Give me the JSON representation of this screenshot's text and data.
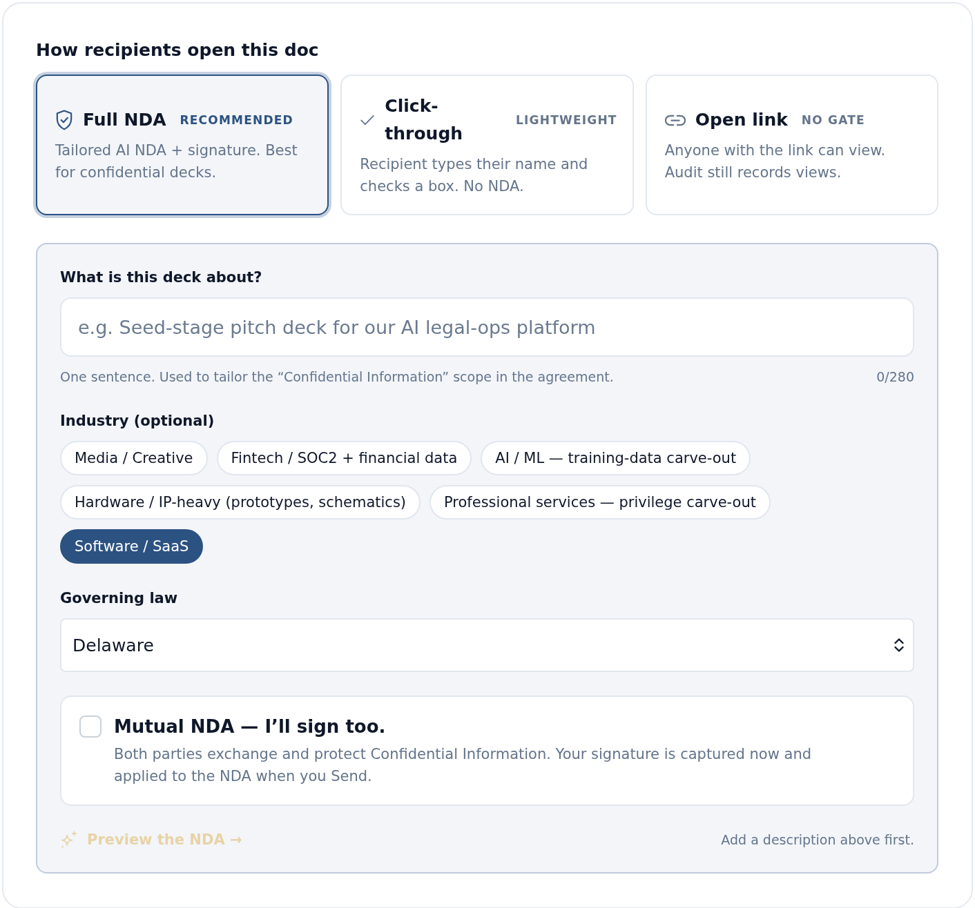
{
  "access": {
    "title": "How recipients open this doc",
    "options": [
      {
        "kind": "nda",
        "title": "Full NDA",
        "badge": "RECOMMENDED",
        "description": "Tailored AI NDA + signature. Best for confidential decks.",
        "selected": true
      },
      {
        "kind": "click",
        "title": "Click-through",
        "badge": "LIGHTWEIGHT",
        "description": "Recipient types their name and checks a box. No NDA.",
        "selected": false
      },
      {
        "kind": "link",
        "title": "Open link",
        "badge": "NO GATE",
        "description": "Anyone with the link can view. Audit still records views.",
        "selected": false
      }
    ]
  },
  "form": {
    "description_field": {
      "label": "What is this deck about?",
      "placeholder": "e.g. Seed-stage pitch deck for our AI legal-ops platform",
      "hint": "One sentence. Used to tailor the “Confidential Information” scope in the agreement.",
      "counter": "0/280"
    },
    "industry": {
      "label": "Industry (optional)",
      "chips": [
        {
          "label": "Media / Creative",
          "selected": false
        },
        {
          "label": "Fintech / SOC2 + financial data",
          "selected": false
        },
        {
          "label": "AI / ML — training-data carve-out",
          "selected": false
        },
        {
          "label": "Hardware / IP-heavy (prototypes, schematics)",
          "selected": false
        },
        {
          "label": "Professional services — privilege carve-out",
          "selected": false
        },
        {
          "label": "Software / SaaS",
          "selected": true
        }
      ]
    },
    "governing_law": {
      "label": "Governing law",
      "value": "Delaware"
    },
    "mutual": {
      "title": "Mutual NDA — I’ll sign too.",
      "description": "Both parties exchange and protect Confidential Information. Your signature is captured now and applied to the NDA when you Send.",
      "checked": false
    },
    "preview": {
      "label": "Preview the NDA →",
      "disabled": true
    },
    "preview_note": "Add a description above first."
  }
}
